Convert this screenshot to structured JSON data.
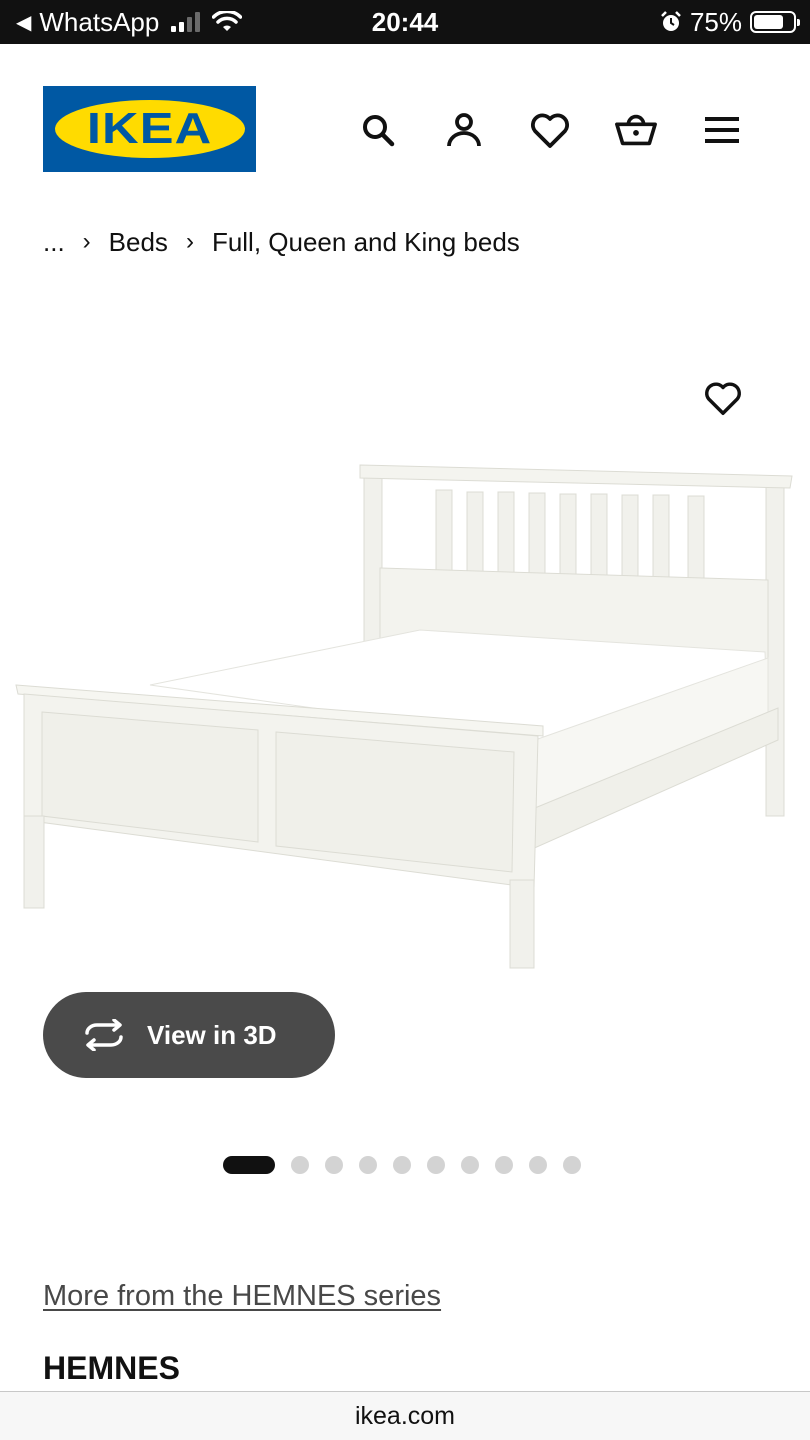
{
  "status_bar": {
    "back_app": "WhatsApp",
    "time": "20:44",
    "battery": "75%",
    "battery_level": 0.75
  },
  "header": {
    "logo_text": "IKEA",
    "icons": [
      "search-icon",
      "account-icon",
      "heart-icon",
      "basket-icon",
      "menu-icon"
    ]
  },
  "breadcrumb": {
    "ellipsis": "...",
    "items": [
      "Beds",
      "Full, Queen and King beds"
    ]
  },
  "product": {
    "view_3d_label": "View in 3D",
    "carousel": {
      "total": 10,
      "active_index": 0
    },
    "series_link": "More from the HEMNES series",
    "name": "HEMNES"
  },
  "browser": {
    "url": "ikea.com"
  },
  "colors": {
    "ikea_blue": "#0058a3",
    "ikea_yellow": "#ffdb00",
    "button_gray": "#4a4a4a"
  }
}
